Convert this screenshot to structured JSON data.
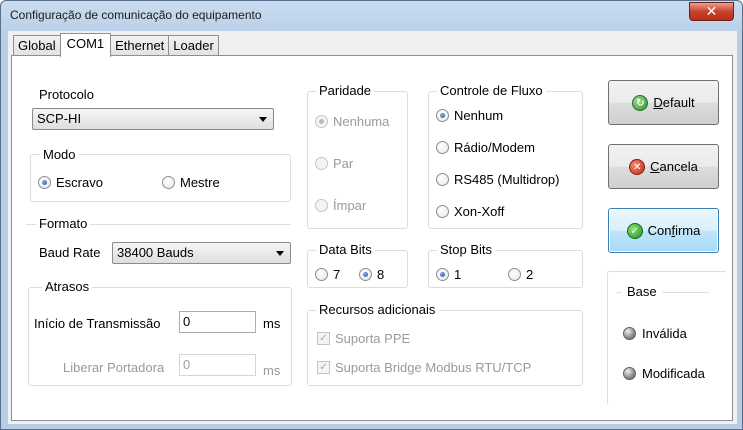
{
  "window": {
    "title": "Configuração de comunicação do equipamento",
    "close_glyph": "✕"
  },
  "tabs": [
    "Global",
    "COM1",
    "Ethernet",
    "Loader"
  ],
  "protocolo": {
    "label": "Protocolo",
    "value": "SCP-HI"
  },
  "modo": {
    "label": "Modo",
    "options": [
      "Escravo",
      "Mestre"
    ],
    "selected": "Escravo"
  },
  "formato": {
    "label": "Formato",
    "baud_label": "Baud Rate",
    "baud_value": "38400 Bauds"
  },
  "atrasos": {
    "label": "Atrasos",
    "inicio_label": "Início de Transmissão",
    "inicio_value": "0",
    "inicio_unit": "ms",
    "liberar_label": "Liberar Portadora",
    "liberar_value": "0",
    "liberar_unit": "ms"
  },
  "paridade": {
    "label": "Paridade",
    "options": [
      "Nenhuma",
      "Par",
      "Ímpar"
    ],
    "selected": "Nenhuma"
  },
  "data_bits": {
    "label": "Data Bits",
    "options": [
      "7",
      "8"
    ],
    "selected": "8"
  },
  "controle_fluxo": {
    "label": "Controle de Fluxo",
    "options": [
      "Nenhum",
      "Rádio/Modem",
      "RS485 (Multidrop)",
      "Xon-Xoff"
    ],
    "selected": "Nenhum"
  },
  "stop_bits": {
    "label": "Stop Bits",
    "options": [
      "1",
      "2"
    ],
    "selected": "1"
  },
  "recursos": {
    "label": "Recursos adicionais",
    "items": [
      "Suporta PPE",
      "Suporta Bridge Modbus RTU/TCP"
    ]
  },
  "buttons": {
    "default_prefix": "",
    "default_key": "D",
    "default_rest": "efault",
    "cancela_prefix": "",
    "cancela_key": "C",
    "cancela_rest": "ancela",
    "confirma_prefix": "Con",
    "confirma_key": "f",
    "confirma_rest": "irma"
  },
  "base": {
    "label": "Base",
    "items": [
      "Inválida",
      "Modificada"
    ]
  }
}
